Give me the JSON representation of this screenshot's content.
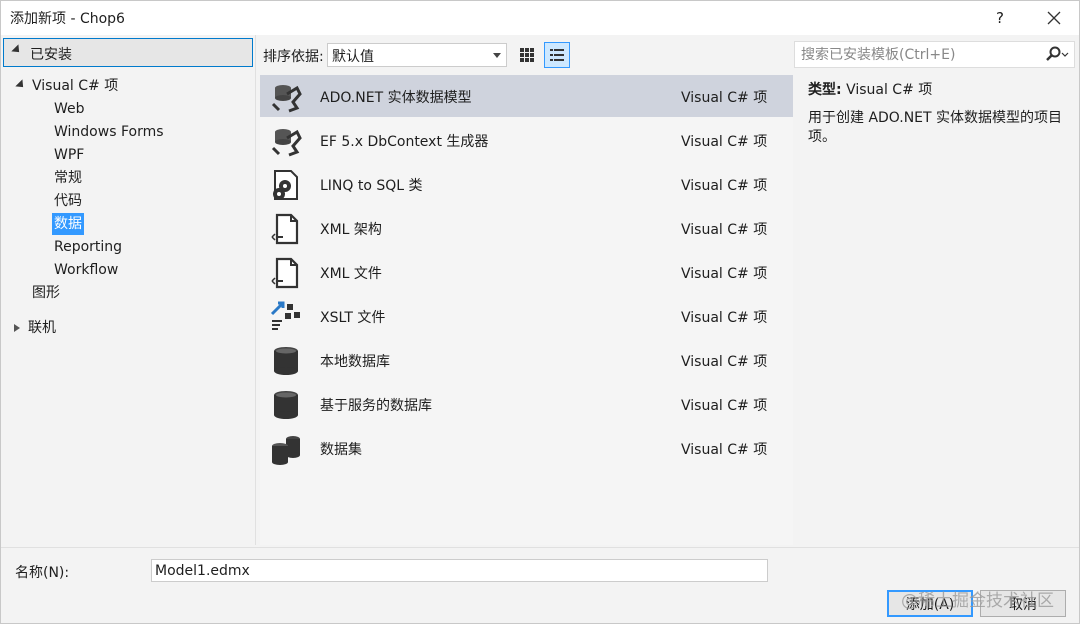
{
  "window": {
    "title": "添加新项 - Chop6",
    "help_label": "?",
    "close_icon": "close-icon"
  },
  "tree": {
    "installed_label": "已安装",
    "root_label": "Visual C# 项",
    "children": [
      "Web",
      "Windows Forms",
      "WPF",
      "常规",
      "代码",
      "数据",
      "Reporting",
      "Workflow"
    ],
    "selected": "数据",
    "graphics_label": "图形",
    "online_label": "联机"
  },
  "toolbar": {
    "sort_label": "排序依据:",
    "sort_value": "默认值",
    "grid_view_icon": "grid-view-icon",
    "list_view_icon": "list-view-icon"
  },
  "templates": [
    {
      "name": "ADO.NET 实体数据模型",
      "type": "Visual C# 项",
      "icon": "entity-model-icon",
      "selected": true
    },
    {
      "name": "EF 5.x DbContext 生成器",
      "type": "Visual C# 项",
      "icon": "dbcontext-generator-icon"
    },
    {
      "name": "LINQ to SQL 类",
      "type": "Visual C# 项",
      "icon": "linq-to-sql-icon"
    },
    {
      "name": "XML 架构",
      "type": "Visual C# 项",
      "icon": "xml-schema-icon"
    },
    {
      "name": "XML 文件",
      "type": "Visual C# 项",
      "icon": "xml-file-icon"
    },
    {
      "name": "XSLT 文件",
      "type": "Visual C# 项",
      "icon": "xslt-file-icon"
    },
    {
      "name": "本地数据库",
      "type": "Visual C# 项",
      "icon": "local-database-icon"
    },
    {
      "name": "基于服务的数据库",
      "type": "Visual C# 项",
      "icon": "service-database-icon"
    },
    {
      "name": "数据集",
      "type": "Visual C# 项",
      "icon": "dataset-icon"
    }
  ],
  "search": {
    "placeholder": "搜索已安装模板(Ctrl+E)",
    "icon": "search-icon"
  },
  "details": {
    "type_key": "类型:",
    "type_value": "Visual C# 项",
    "description": "用于创建 ADO.NET 实体数据模型的项目项。"
  },
  "footer": {
    "name_label": "名称(N):",
    "name_value": "Model1.edmx",
    "add_label": "添加(A)",
    "cancel_label": "取消",
    "watermark": "@稀土掘金技术社区"
  },
  "colors": {
    "accent": "#3399ff",
    "selected_row": "#cfd3dd",
    "focus_border": "#007acc"
  }
}
